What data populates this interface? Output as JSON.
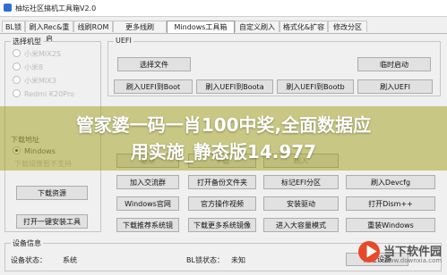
{
  "window": {
    "title": "柚坛社区搞机工具箱V2.0"
  },
  "tabs": [
    {
      "label": "BL锁"
    },
    {
      "label": "刷入Rec&重启"
    },
    {
      "label": "线刷ROM"
    },
    {
      "label": "更多线刷"
    },
    {
      "label": "Mindows工具箱"
    },
    {
      "label": "自定义刷入"
    },
    {
      "label": "格式化&扩容"
    },
    {
      "label": "修改分区"
    }
  ],
  "left_panel": {
    "title": "选择机型",
    "models": [
      {
        "label": "小米MIX2S"
      },
      {
        "label": "小米8"
      },
      {
        "label": "小米MIX3"
      },
      {
        "label": "Redmi K20Pro"
      }
    ],
    "download_label": "下载地址",
    "download_option": "Mindows",
    "unsupported_note": "下载镜像暂不支持",
    "download_resource_button": "下载资源",
    "open_install_tool_button": "打开一键安装工具"
  },
  "uefi_group": {
    "title": "UEFI",
    "buttons": [
      {
        "label": "选择文件"
      },
      {
        "label": "临时启动"
      },
      {
        "label": "刷入UEFI到Boot"
      },
      {
        "label": "刷入UEFI到Boota"
      },
      {
        "label": "刷入UEFI到Bootb"
      },
      {
        "label": "刷入UEFI"
      }
    ]
  },
  "tools_grid": [
    {
      "label": "驱动"
    },
    {
      "label": "下载"
    },
    {
      "label": "刷入"
    },
    {
      "label": "刷入Devcfg"
    },
    {
      "label": "加入交流群"
    },
    {
      "label": "打开备份文件夹"
    },
    {
      "label": "标记EFI分区"
    },
    {
      "label": "Windows官网"
    },
    {
      "label": "官方操作视频"
    },
    {
      "label": "安装驱动"
    },
    {
      "label": "打开Dism++"
    },
    {
      "label": "下载推荐系统镜"
    },
    {
      "label": "下载更多系统镜像"
    },
    {
      "label": "进入大容量模式"
    },
    {
      "label": "重装Windows"
    }
  ],
  "device_info": {
    "title": "设备信息",
    "state_label": "设备状态：",
    "state_value": "系统",
    "bl_label": "BL锁状态：",
    "bl_value": "未知",
    "check_button": "检查设备"
  },
  "overlay": {
    "line1": "管家婆一码一肖100中奖,全面数据应",
    "line2": "用实施_静态版14.977"
  },
  "watermark": {
    "name": "当下软件园",
    "url": "www.downxia.com"
  }
}
